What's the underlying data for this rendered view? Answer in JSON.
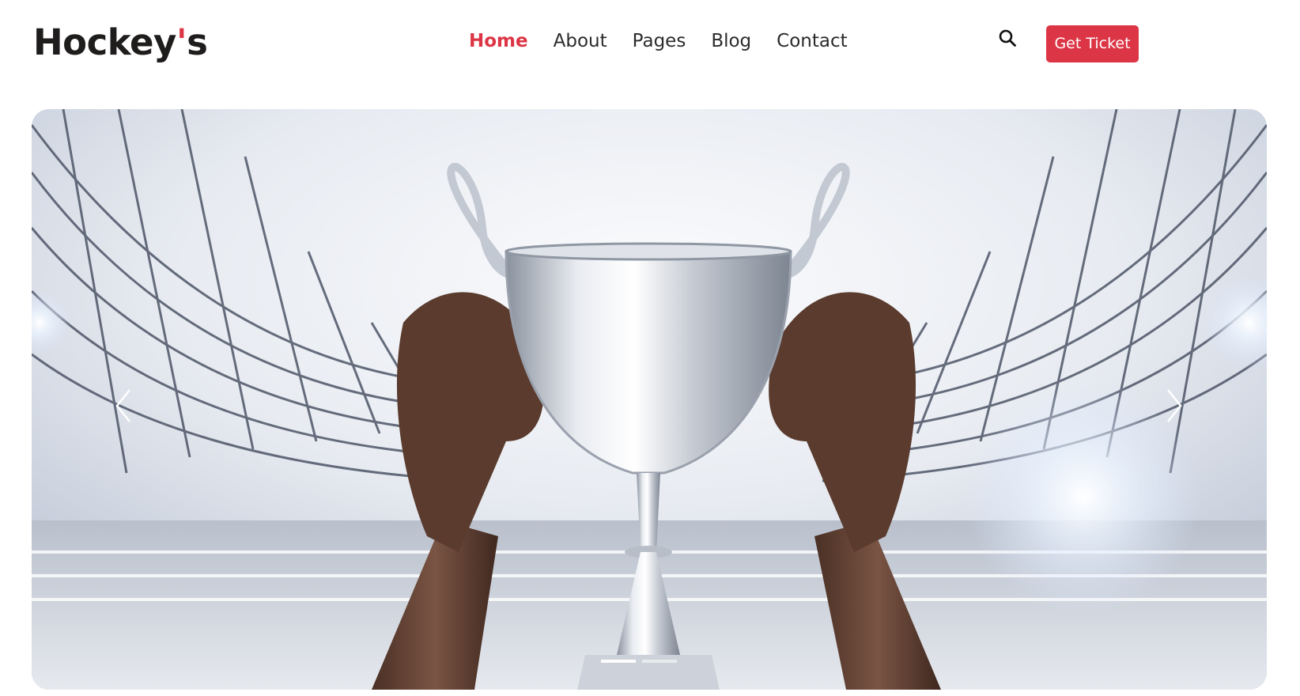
{
  "brand": {
    "name_main": "Hockey",
    "name_apos": "'",
    "name_end": "s"
  },
  "nav": {
    "items": [
      {
        "label": "Home",
        "active": true
      },
      {
        "label": "About",
        "active": false
      },
      {
        "label": "Pages",
        "active": false
      },
      {
        "label": "Blog",
        "active": false
      },
      {
        "label": "Contact",
        "active": false
      }
    ]
  },
  "header": {
    "search_icon": "search-icon",
    "cta_label": "Get Ticket"
  },
  "hero": {
    "image": "trophy-held-in-stadium",
    "prev_icon": "chevron-left-icon",
    "next_icon": "chevron-right-icon",
    "slides": 2,
    "active_slide": 1
  },
  "colors": {
    "accent": "#dc3545",
    "text": "#2b2b2b"
  }
}
